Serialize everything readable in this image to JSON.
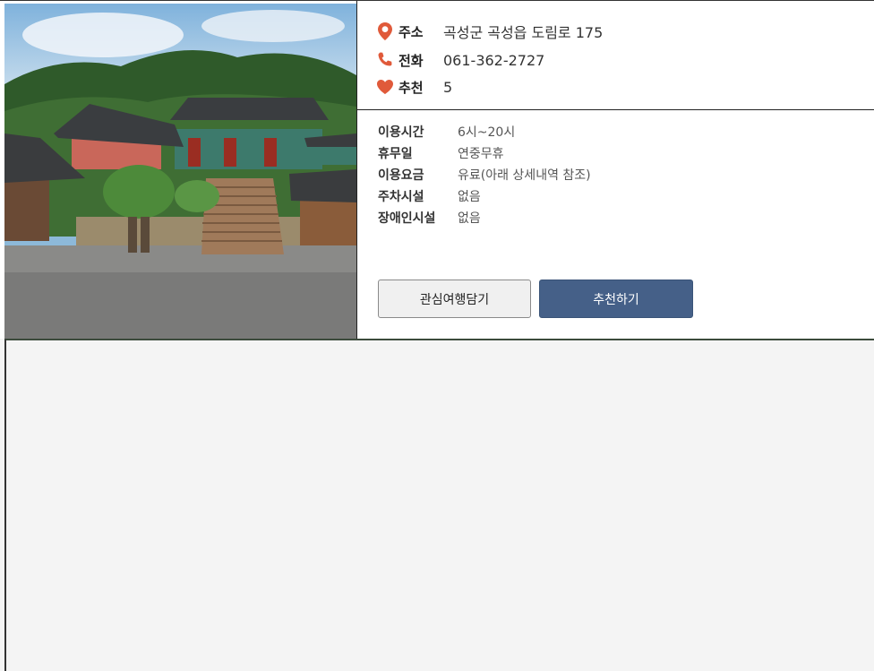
{
  "info": {
    "address_label": "주소",
    "address_value": "곡성군 곡성읍 도림로 175",
    "phone_label": "전화",
    "phone_value": "061-362-2727",
    "recommend_label": "추천",
    "recommend_value": "5"
  },
  "details": [
    {
      "label": "이용시간",
      "value": "6시~20시"
    },
    {
      "label": "휴무일",
      "value": "연중무휴"
    },
    {
      "label": "이용요금",
      "value": "유료(아래 상세내역 참조)"
    },
    {
      "label": "주차시설",
      "value": "없음"
    },
    {
      "label": "장애인시설",
      "value": "없음"
    }
  ],
  "buttons": {
    "save_label": "관심여행담기",
    "recommend_label": "추천하기"
  },
  "colors": {
    "icon_accent": "#e05a3a",
    "recommend_button": "#456088"
  },
  "icons": {
    "address": "map-pin-icon",
    "phone": "phone-icon",
    "recommend": "heart-icon"
  }
}
